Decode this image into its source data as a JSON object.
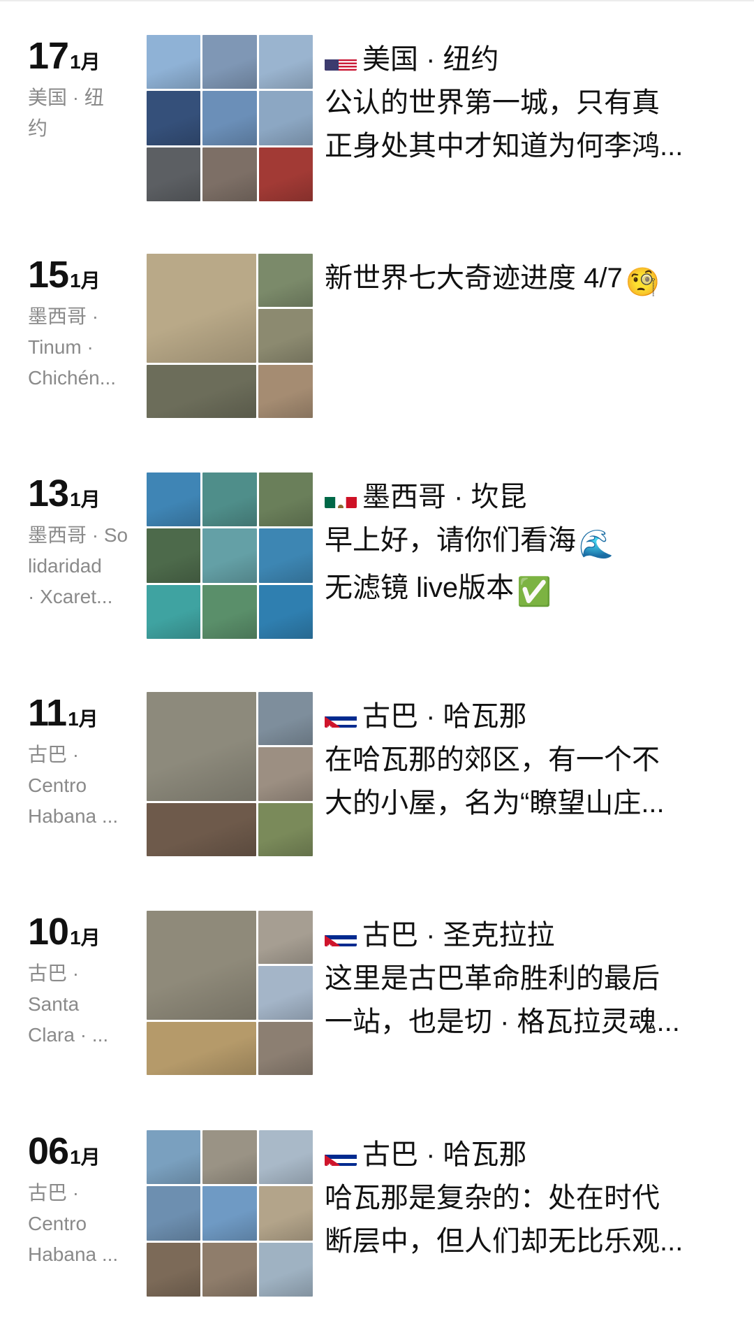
{
  "entries": [
    {
      "day": "17",
      "month": "1月",
      "location_lines": [
        "美国 · 纽",
        "约"
      ],
      "flag": "us",
      "place": "美国 · 纽约",
      "desc_lines": [
        "公认的世界第一城，只有真",
        "正身处其中才知道为何李鸿..."
      ],
      "layout": "g9",
      "photos": [
        "#8fb2d6",
        "#7f97b5",
        "#9ab4cf",
        "#35507a",
        "#6b8fb8",
        "#8ca7c3",
        "#5c5f63",
        "#7d6f66",
        "#a23a35"
      ]
    },
    {
      "day": "15",
      "month": "1月",
      "location_lines": [
        "墨西哥 ·",
        "Tinum ·",
        "Chichén..."
      ],
      "flag": "",
      "place": "",
      "desc_lines": [
        "新世界七大奇迹进度 4/7"
      ],
      "desc_emoji": "🧐",
      "layout": "gbig",
      "photos": [
        "#b9a988",
        "#7b8a6a",
        "#8c8a70",
        "#6c6d5a",
        "#a58c72",
        "#c0b79c"
      ]
    },
    {
      "day": "13",
      "month": "1月",
      "location_lines": [
        "墨西哥 · So",
        "lidaridad",
        "· Xcaret..."
      ],
      "flag": "mx",
      "place": "墨西哥 · 坎昆",
      "desc_lines": [
        "早上好，请你们看海",
        "无滤镜 live版本"
      ],
      "desc_line_emojis": [
        "🌊",
        "✅"
      ],
      "layout": "g9",
      "photos": [
        "#3f85b5",
        "#4f8e8a",
        "#6a7f5a",
        "#4d6a4b",
        "#64a0a6",
        "#3d86b3",
        "#3fa3a1",
        "#5a8f6a",
        "#2f7fb0"
      ]
    },
    {
      "day": "11",
      "month": "1月",
      "location_lines": [
        "古巴 ·",
        "Centro",
        "Habana ..."
      ],
      "flag": "cu",
      "place": "古巴 · 哈瓦那",
      "desc_lines": [
        "在哈瓦那的郊区，有一个不",
        "大的小屋，名为“瞭望山庄..."
      ],
      "layout": "gbig",
      "photos": [
        "#8d8a7c",
        "#7e8e9c",
        "#9c8f82",
        "#6e5a4b",
        "#7a8a5a",
        "#4f7f9a"
      ]
    },
    {
      "day": "10",
      "month": "1月",
      "location_lines": [
        "古巴 ·",
        "Santa",
        "Clara · ..."
      ],
      "flag": "cu",
      "place": "古巴 · 圣克拉拉",
      "desc_lines": [
        "这里是古巴革命胜利的最后",
        "一站，也是切 · 格瓦拉灵魂..."
      ],
      "layout": "gbig",
      "photos": [
        "#8f8a7a",
        "#a69e92",
        "#a4b5c8",
        "#b59a6a",
        "#8c7f72",
        "#c09a6e"
      ]
    },
    {
      "day": "06",
      "month": "1月",
      "location_lines": [
        "古巴 ·",
        "Centro",
        "Habana ..."
      ],
      "flag": "cu",
      "place": "古巴 · 哈瓦那",
      "desc_lines": [
        "哈瓦那是复杂的：处在时代",
        "断层中，但人们却无比乐观..."
      ],
      "layout": "g9",
      "photos": [
        "#7aa0bf",
        "#9a9385",
        "#a9b9c8",
        "#6d8fb0",
        "#6f9ac4",
        "#b3a48a",
        "#7c6a58",
        "#8f7d6b",
        "#9fb2c2"
      ]
    }
  ]
}
